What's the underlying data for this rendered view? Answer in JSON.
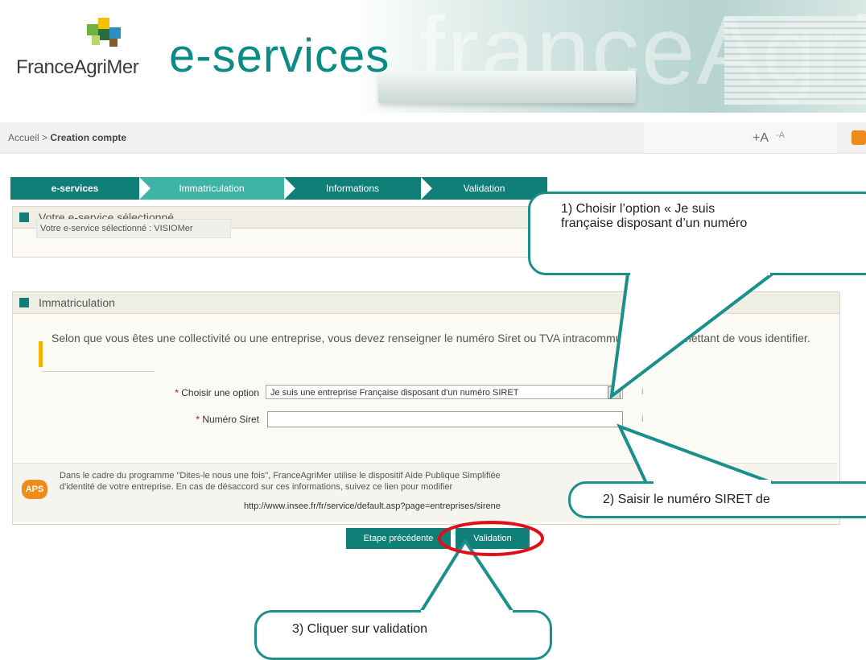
{
  "header": {
    "org_name": "FranceAgriMer",
    "brand": "e-services",
    "watermark": "franceAgriMer"
  },
  "breadcrumb": {
    "home": "Accueil",
    "separator": ">",
    "current": "Creation compte"
  },
  "font_controls": {
    "increase": "+A",
    "decrease": "-A"
  },
  "steps": [
    {
      "label": "e-services",
      "active": false
    },
    {
      "label": "Immatriculation",
      "active": true
    },
    {
      "label": "Informations",
      "active": false
    },
    {
      "label": "Validation",
      "active": false
    }
  ],
  "selected_panel": {
    "title": "Votre e-service sélectionné",
    "value": "Votre e-service sélectionné : VISIOMer"
  },
  "immat_panel": {
    "title": "Immatriculation",
    "intro": "Selon que vous êtes une collectivité ou une entreprise, vous devez renseigner le numéro Siret ou TVA intracommunautaire permettant de vous identifier.",
    "required_mark": "*",
    "option_label": "Choisir une option",
    "option_value": "Je suis une entreprise Française disposant d'un numéro SIRET",
    "siret_label": "Numéro Siret",
    "siret_value": "",
    "info_glyph": "i"
  },
  "aps": {
    "badge": "APS",
    "text_line1": "Dans le cadre du programme \"Dites-le nous une fois\", FranceAgriMer utilise le dispositif Aide Publique Simplifiée",
    "text_line2": "d'identité de votre entreprise. En cas de désaccord sur ces informations, suivez ce lien pour modifier",
    "link": "http://www.insee.fr/fr/service/default.asp?page=entreprises/sirene"
  },
  "buttons": {
    "previous": "Etape précédente",
    "validate": "Validation"
  },
  "callouts": {
    "c1_line1": "1) Choisir   l’option   « Je   suis",
    "c1_line2": "française disposant d’un numéro",
    "c2": "2) Saisir le numéro SIRET de",
    "c3": "3) Cliquer sur validation"
  },
  "colors": {
    "teal": "#0f7f78",
    "teal_light": "#3fb3a6",
    "callout_border": "#1b8f8a",
    "highlight_red": "#e0101a",
    "aps_orange": "#f08a1d"
  }
}
